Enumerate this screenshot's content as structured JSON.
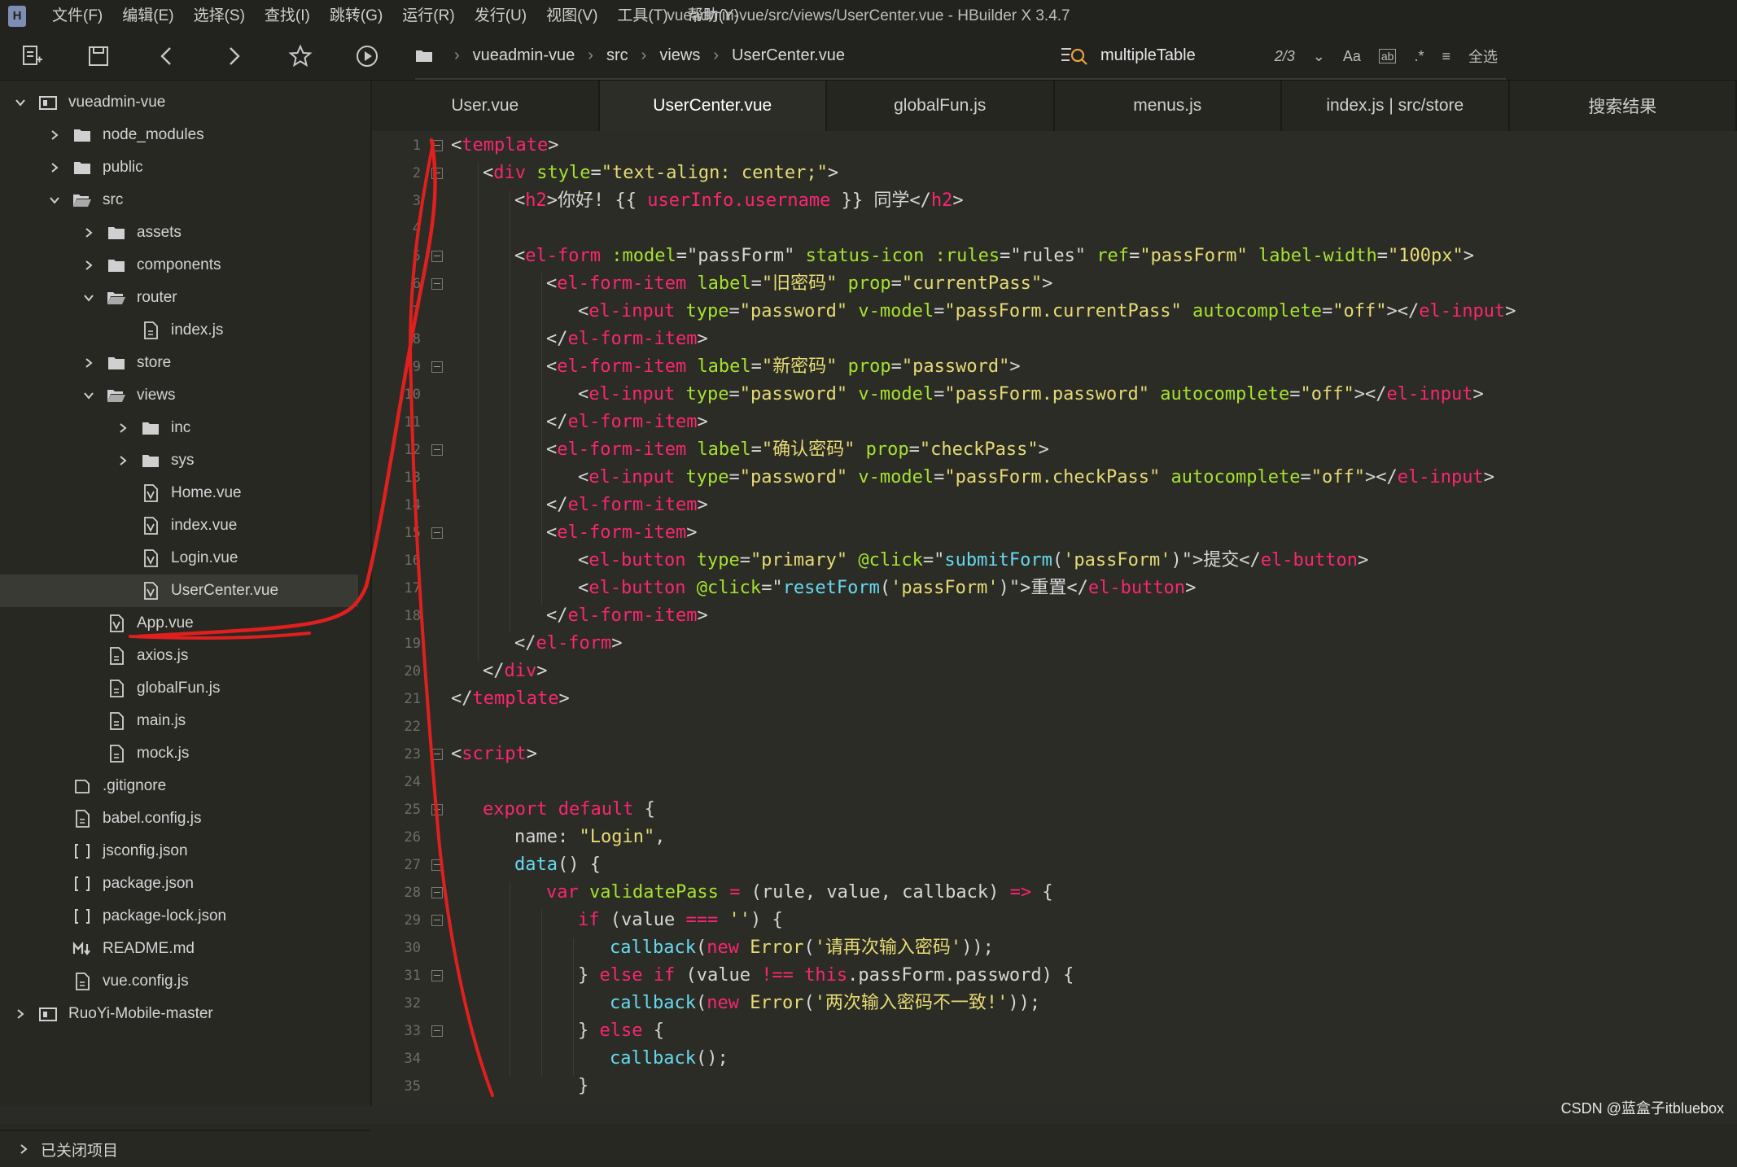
{
  "window": {
    "title": "vueadmin-vue/src/views/UserCenter.vue - HBuilder X 3.4.7",
    "logo": "H"
  },
  "menu": [
    "文件(F)",
    "编辑(E)",
    "选择(S)",
    "查找(I)",
    "跳转(G)",
    "运行(R)",
    "发行(U)",
    "视图(V)",
    "工具(T)",
    "帮助(Y)"
  ],
  "toolbar": {
    "breadcrumb": [
      "vueadmin-vue",
      "src",
      "views",
      "UserCenter.vue"
    ],
    "search_value": "multipleTable",
    "match_count": "2/3",
    "case_label": "Aa",
    "word_label": "ab",
    "regex_label": ".*",
    "select_all_label": "全选"
  },
  "tree": [
    {
      "label": "vueadmin-vue",
      "level": 0,
      "kind": "project",
      "state": "open"
    },
    {
      "label": "node_modules",
      "level": 1,
      "kind": "folder",
      "state": "closed"
    },
    {
      "label": "public",
      "level": 1,
      "kind": "folder",
      "state": "closed"
    },
    {
      "label": "src",
      "level": 1,
      "kind": "folder-open",
      "state": "open"
    },
    {
      "label": "assets",
      "level": 2,
      "kind": "folder",
      "state": "closed"
    },
    {
      "label": "components",
      "level": 2,
      "kind": "folder",
      "state": "closed"
    },
    {
      "label": "router",
      "level": 2,
      "kind": "folder-open",
      "state": "open"
    },
    {
      "label": "index.js",
      "level": 3,
      "kind": "js"
    },
    {
      "label": "store",
      "level": 2,
      "kind": "folder",
      "state": "closed"
    },
    {
      "label": "views",
      "level": 2,
      "kind": "folder-open",
      "state": "open"
    },
    {
      "label": "inc",
      "level": 3,
      "kind": "folder",
      "state": "closed"
    },
    {
      "label": "sys",
      "level": 3,
      "kind": "folder",
      "state": "closed"
    },
    {
      "label": "Home.vue",
      "level": 3,
      "kind": "vue"
    },
    {
      "label": "index.vue",
      "level": 3,
      "kind": "vue"
    },
    {
      "label": "Login.vue",
      "level": 3,
      "kind": "vue"
    },
    {
      "label": "UserCenter.vue",
      "level": 3,
      "kind": "vue",
      "selected": true
    },
    {
      "label": "App.vue",
      "level": 2,
      "kind": "vue"
    },
    {
      "label": "axios.js",
      "level": 2,
      "kind": "js"
    },
    {
      "label": "globalFun.js",
      "level": 2,
      "kind": "js"
    },
    {
      "label": "main.js",
      "level": 2,
      "kind": "js"
    },
    {
      "label": "mock.js",
      "level": 2,
      "kind": "js"
    },
    {
      "label": ".gitignore",
      "level": 1,
      "kind": "file"
    },
    {
      "label": "babel.config.js",
      "level": 1,
      "kind": "js"
    },
    {
      "label": "jsconfig.json",
      "level": 1,
      "kind": "json"
    },
    {
      "label": "package.json",
      "level": 1,
      "kind": "json"
    },
    {
      "label": "package-lock.json",
      "level": 1,
      "kind": "json"
    },
    {
      "label": "README.md",
      "level": 1,
      "kind": "md"
    },
    {
      "label": "vue.config.js",
      "level": 1,
      "kind": "js"
    },
    {
      "label": "RuoYi-Mobile-master",
      "level": 0,
      "kind": "project",
      "state": "closed"
    }
  ],
  "closed_projects_label": "已关闭项目",
  "tabs": [
    {
      "label": "User.vue",
      "active": false
    },
    {
      "label": "UserCenter.vue",
      "active": true
    },
    {
      "label": "globalFun.js",
      "active": false
    },
    {
      "label": "menus.js",
      "active": false
    },
    {
      "label": "index.js | src/store",
      "active": false
    },
    {
      "label": "搜索结果",
      "active": false
    }
  ],
  "code": [
    {
      "n": 1,
      "fold": true,
      "indent": 0,
      "tokens": [
        [
          "p",
          "<"
        ],
        [
          "g",
          "template"
        ],
        [
          "p",
          ">"
        ]
      ]
    },
    {
      "n": 2,
      "fold": true,
      "indent": 1,
      "tokens": [
        [
          "p",
          "<"
        ],
        [
          "g",
          "div "
        ],
        [
          "a",
          "style"
        ],
        [
          "p",
          "="
        ],
        [
          "s",
          "\"text-align: center;\""
        ],
        [
          "p",
          ">"
        ]
      ]
    },
    {
      "n": 3,
      "fold": false,
      "indent": 2,
      "tokens": [
        [
          "p",
          "<"
        ],
        [
          "g",
          "h2"
        ],
        [
          "p",
          ">你好! {{ "
        ],
        [
          "g",
          "userInfo.username"
        ],
        [
          "p",
          " }} 同学</"
        ],
        [
          "g",
          "h2"
        ],
        [
          "p",
          ">"
        ]
      ]
    },
    {
      "n": 4,
      "fold": false,
      "indent": 0,
      "tokens": []
    },
    {
      "n": 5,
      "fold": true,
      "indent": 2,
      "tokens": [
        [
          "p",
          "<"
        ],
        [
          "g",
          "el-form "
        ],
        [
          "a",
          ":model"
        ],
        [
          "p",
          "=\"passForm\" "
        ],
        [
          "a",
          "status-icon "
        ],
        [
          "a",
          ":rules"
        ],
        [
          "p",
          "=\"rules\" "
        ],
        [
          "a",
          "ref"
        ],
        [
          "p",
          "="
        ],
        [
          "s",
          "\"passForm\""
        ],
        [
          "p",
          " "
        ],
        [
          "a",
          "label-width"
        ],
        [
          "p",
          "="
        ],
        [
          "s",
          "\"100px\""
        ],
        [
          "p",
          ">"
        ]
      ]
    },
    {
      "n": 6,
      "fold": true,
      "indent": 3,
      "tokens": [
        [
          "p",
          "<"
        ],
        [
          "g",
          "el-form-item "
        ],
        [
          "a",
          "label"
        ],
        [
          "p",
          "="
        ],
        [
          "s",
          "\"旧密码\""
        ],
        [
          "p",
          " "
        ],
        [
          "a",
          "prop"
        ],
        [
          "p",
          "="
        ],
        [
          "s",
          "\"currentPass\""
        ],
        [
          "p",
          ">"
        ]
      ]
    },
    {
      "n": 7,
      "fold": false,
      "indent": 4,
      "tokens": [
        [
          "p",
          "<"
        ],
        [
          "g",
          "el-input "
        ],
        [
          "a",
          "type"
        ],
        [
          "p",
          "="
        ],
        [
          "s",
          "\"password\""
        ],
        [
          "p",
          " "
        ],
        [
          "a",
          "v-model"
        ],
        [
          "p",
          "="
        ],
        [
          "s",
          "\"passForm.currentPass\""
        ],
        [
          "p",
          " "
        ],
        [
          "a",
          "autocomplete"
        ],
        [
          "p",
          "="
        ],
        [
          "s",
          "\"off\""
        ],
        [
          "p",
          "></"
        ],
        [
          "g",
          "el-input"
        ],
        [
          "p",
          ">"
        ]
      ]
    },
    {
      "n": 8,
      "fold": false,
      "indent": 3,
      "tokens": [
        [
          "p",
          "</"
        ],
        [
          "g",
          "el-form-item"
        ],
        [
          "p",
          ">"
        ]
      ]
    },
    {
      "n": 9,
      "fold": true,
      "indent": 3,
      "tokens": [
        [
          "p",
          "<"
        ],
        [
          "g",
          "el-form-item "
        ],
        [
          "a",
          "label"
        ],
        [
          "p",
          "="
        ],
        [
          "s",
          "\"新密码\""
        ],
        [
          "p",
          " "
        ],
        [
          "a",
          "prop"
        ],
        [
          "p",
          "="
        ],
        [
          "s",
          "\"password\""
        ],
        [
          "p",
          ">"
        ]
      ]
    },
    {
      "n": 10,
      "fold": false,
      "indent": 4,
      "tokens": [
        [
          "p",
          "<"
        ],
        [
          "g",
          "el-input "
        ],
        [
          "a",
          "type"
        ],
        [
          "p",
          "="
        ],
        [
          "s",
          "\"password\""
        ],
        [
          "p",
          " "
        ],
        [
          "a",
          "v-model"
        ],
        [
          "p",
          "="
        ],
        [
          "s",
          "\"passForm.password\""
        ],
        [
          "p",
          " "
        ],
        [
          "a",
          "autocomplete"
        ],
        [
          "p",
          "="
        ],
        [
          "s",
          "\"off\""
        ],
        [
          "p",
          "></"
        ],
        [
          "g",
          "el-input"
        ],
        [
          "p",
          ">"
        ]
      ]
    },
    {
      "n": 11,
      "fold": false,
      "indent": 3,
      "tokens": [
        [
          "p",
          "</"
        ],
        [
          "g",
          "el-form-item"
        ],
        [
          "p",
          ">"
        ]
      ]
    },
    {
      "n": 12,
      "fold": true,
      "indent": 3,
      "tokens": [
        [
          "p",
          "<"
        ],
        [
          "g",
          "el-form-item "
        ],
        [
          "a",
          "label"
        ],
        [
          "p",
          "="
        ],
        [
          "s",
          "\"确认密码\""
        ],
        [
          "p",
          " "
        ],
        [
          "a",
          "prop"
        ],
        [
          "p",
          "="
        ],
        [
          "s",
          "\"checkPass\""
        ],
        [
          "p",
          ">"
        ]
      ]
    },
    {
      "n": 13,
      "fold": false,
      "indent": 4,
      "tokens": [
        [
          "p",
          "<"
        ],
        [
          "g",
          "el-input "
        ],
        [
          "a",
          "type"
        ],
        [
          "p",
          "="
        ],
        [
          "s",
          "\"password\""
        ],
        [
          "p",
          " "
        ],
        [
          "a",
          "v-model"
        ],
        [
          "p",
          "="
        ],
        [
          "s",
          "\"passForm.checkPass\""
        ],
        [
          "p",
          " "
        ],
        [
          "a",
          "autocomplete"
        ],
        [
          "p",
          "="
        ],
        [
          "s",
          "\"off\""
        ],
        [
          "p",
          "></"
        ],
        [
          "g",
          "el-input"
        ],
        [
          "p",
          ">"
        ]
      ]
    },
    {
      "n": 14,
      "fold": false,
      "indent": 3,
      "tokens": [
        [
          "p",
          "</"
        ],
        [
          "g",
          "el-form-item"
        ],
        [
          "p",
          ">"
        ]
      ]
    },
    {
      "n": 15,
      "fold": true,
      "indent": 3,
      "tokens": [
        [
          "p",
          "<"
        ],
        [
          "g",
          "el-form-item"
        ],
        [
          "p",
          ">"
        ]
      ]
    },
    {
      "n": 16,
      "fold": false,
      "indent": 4,
      "tokens": [
        [
          "p",
          "<"
        ],
        [
          "g",
          "el-button "
        ],
        [
          "a",
          "type"
        ],
        [
          "p",
          "="
        ],
        [
          "s",
          "\"primary\""
        ],
        [
          "p",
          " "
        ],
        [
          "a",
          "@click"
        ],
        [
          "p",
          "=\""
        ],
        [
          "f",
          "submitForm"
        ],
        [
          "p",
          "("
        ],
        [
          "s",
          "'passForm'"
        ],
        [
          "p",
          ")\">提交</"
        ],
        [
          "g",
          "el-button"
        ],
        [
          "p",
          ">"
        ]
      ]
    },
    {
      "n": 17,
      "fold": false,
      "indent": 4,
      "tokens": [
        [
          "p",
          "<"
        ],
        [
          "g",
          "el-button "
        ],
        [
          "a",
          "@click"
        ],
        [
          "p",
          "=\""
        ],
        [
          "f",
          "resetForm"
        ],
        [
          "p",
          "("
        ],
        [
          "s",
          "'passForm'"
        ],
        [
          "p",
          ")\">重置</"
        ],
        [
          "g",
          "el-button"
        ],
        [
          "p",
          ">"
        ]
      ]
    },
    {
      "n": 18,
      "fold": false,
      "indent": 3,
      "tokens": [
        [
          "p",
          "</"
        ],
        [
          "g",
          "el-form-item"
        ],
        [
          "p",
          ">"
        ]
      ]
    },
    {
      "n": 19,
      "fold": false,
      "indent": 2,
      "tokens": [
        [
          "p",
          "</"
        ],
        [
          "g",
          "el-form"
        ],
        [
          "p",
          ">"
        ]
      ]
    },
    {
      "n": 20,
      "fold": false,
      "indent": 1,
      "tokens": [
        [
          "p",
          "</"
        ],
        [
          "g",
          "div"
        ],
        [
          "p",
          ">"
        ]
      ]
    },
    {
      "n": 21,
      "fold": false,
      "indent": 0,
      "tokens": [
        [
          "p",
          "</"
        ],
        [
          "g",
          "template"
        ],
        [
          "p",
          ">"
        ]
      ]
    },
    {
      "n": 22,
      "fold": false,
      "indent": 0,
      "tokens": []
    },
    {
      "n": 23,
      "fold": true,
      "indent": 0,
      "tokens": [
        [
          "p",
          "<"
        ],
        [
          "g",
          "script"
        ],
        [
          "p",
          ">"
        ]
      ]
    },
    {
      "n": 24,
      "fold": false,
      "indent": 0,
      "tokens": []
    },
    {
      "n": 25,
      "fold": true,
      "indent": 1,
      "tokens": [
        [
          "k",
          "export default"
        ],
        [
          "p",
          " {"
        ]
      ]
    },
    {
      "n": 26,
      "fold": false,
      "indent": 2,
      "tokens": [
        [
          "p",
          "name: "
        ],
        [
          "s",
          "\"Login\""
        ],
        [
          "p",
          ","
        ]
      ]
    },
    {
      "n": 27,
      "fold": true,
      "indent": 2,
      "tokens": [
        [
          "f",
          "data"
        ],
        [
          "p",
          "() {"
        ]
      ]
    },
    {
      "n": 28,
      "fold": true,
      "indent": 3,
      "tokens": [
        [
          "k",
          "var "
        ],
        [
          "a",
          "validatePass"
        ],
        [
          "p",
          " "
        ],
        [
          "k",
          "="
        ],
        [
          "p",
          " (rule, value, callback) "
        ],
        [
          "k",
          "=>"
        ],
        [
          "p",
          " {"
        ]
      ]
    },
    {
      "n": 29,
      "fold": true,
      "indent": 4,
      "tokens": [
        [
          "k",
          "if"
        ],
        [
          "p",
          " (value "
        ],
        [
          "k",
          "==="
        ],
        [
          "p",
          " "
        ],
        [
          "s",
          "''"
        ],
        [
          "p",
          ") {"
        ]
      ]
    },
    {
      "n": 30,
      "fold": false,
      "indent": 5,
      "tokens": [
        [
          "f",
          "callback"
        ],
        [
          "p",
          "("
        ],
        [
          "k",
          "new "
        ],
        [
          "t",
          "Error"
        ],
        [
          "p",
          "("
        ],
        [
          "s",
          "'请再次输入密码'"
        ],
        [
          "p",
          "));"
        ]
      ]
    },
    {
      "n": 31,
      "fold": true,
      "indent": 4,
      "tokens": [
        [
          "p",
          "} "
        ],
        [
          "k",
          "else if"
        ],
        [
          "p",
          " (value "
        ],
        [
          "k",
          "!=="
        ],
        [
          "p",
          " "
        ],
        [
          "k",
          "this"
        ],
        [
          "p",
          ".passForm.password) {"
        ]
      ]
    },
    {
      "n": 32,
      "fold": false,
      "indent": 5,
      "tokens": [
        [
          "f",
          "callback"
        ],
        [
          "p",
          "("
        ],
        [
          "k",
          "new "
        ],
        [
          "t",
          "Error"
        ],
        [
          "p",
          "("
        ],
        [
          "s",
          "'两次输入密码不一致!'"
        ],
        [
          "p",
          "));"
        ]
      ]
    },
    {
      "n": 33,
      "fold": true,
      "indent": 4,
      "tokens": [
        [
          "p",
          "} "
        ],
        [
          "k",
          "else"
        ],
        [
          "p",
          " {"
        ]
      ]
    },
    {
      "n": 34,
      "fold": false,
      "indent": 5,
      "tokens": [
        [
          "f",
          "callback"
        ],
        [
          "p",
          "();"
        ]
      ]
    },
    {
      "n": 35,
      "fold": false,
      "indent": 4,
      "tokens": [
        [
          "p",
          "}"
        ]
      ]
    }
  ],
  "colors": {
    "tag": "#f92672",
    "attr": "#a6e22e",
    "string": "#e6db74",
    "function": "#66d9ef",
    "annotation": "#e01f1f"
  },
  "watermark": "CSDN @蓝盒子itbluebox"
}
